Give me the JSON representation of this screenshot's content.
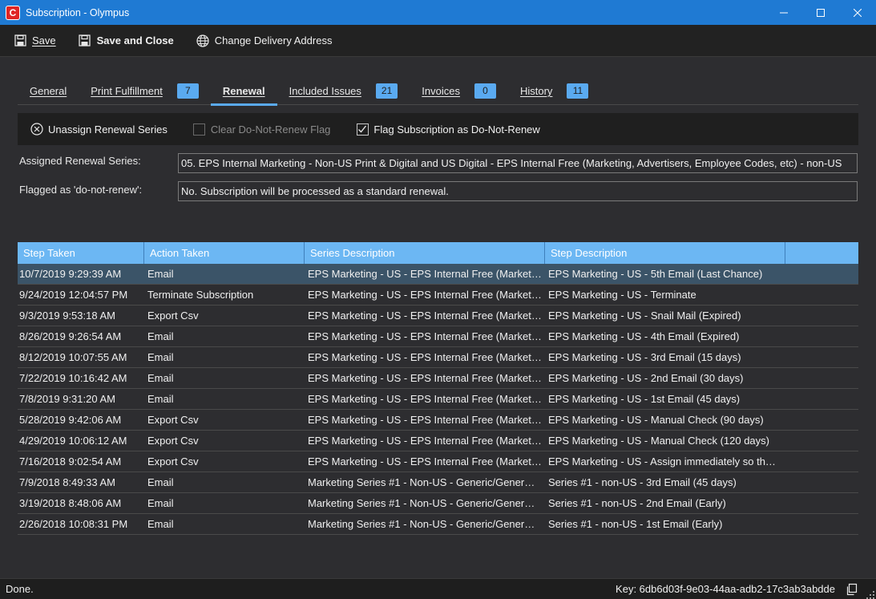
{
  "window": {
    "title": "Subscription - Olympus",
    "app_icon": "C",
    "minimize": "—",
    "maximize": "☐",
    "close": "✕"
  },
  "toolbar": {
    "save_label": "Save",
    "save_close_label": "Save and Close",
    "change_address_label": "Change Delivery Address"
  },
  "tabs": [
    {
      "label": "General",
      "badge": null
    },
    {
      "label": "Print Fulfillment",
      "badge": "7"
    },
    {
      "label": "Renewal",
      "badge": null
    },
    {
      "label": "Included Issues",
      "badge": "21"
    },
    {
      "label": "Invoices",
      "badge": "0"
    },
    {
      "label": "History",
      "badge": "11"
    }
  ],
  "actions": {
    "unassign_label": "Unassign Renewal Series",
    "clear_flag_label": "Clear Do-Not-Renew Flag",
    "flag_label": "Flag Subscription as Do-Not-Renew"
  },
  "fields": {
    "assigned_label": "Assigned Renewal Series:",
    "assigned_value": "05. EPS Internal Marketing - Non-US Print & Digital and US Digital - EPS Internal Free (Marketing, Advertisers, Employee Codes, etc) - non-US",
    "flagged_label": "Flagged as 'do-not-renew':",
    "flagged_value": "No. Subscription will be processed as a standard renewal."
  },
  "grid": {
    "columns": [
      "Step Taken",
      "Action Taken",
      "Series Description",
      "Step Description",
      ""
    ],
    "rows": [
      [
        "10/7/2019 9:29:39 AM",
        "Email",
        "EPS Marketing - US - EPS Internal Free (Market…",
        "EPS Marketing - US - 5th Email (Last Chance)"
      ],
      [
        "9/24/2019 12:04:57 PM",
        "Terminate Subscription",
        "EPS Marketing - US - EPS Internal Free (Market…",
        "EPS Marketing - US - Terminate"
      ],
      [
        "9/3/2019 9:53:18 AM",
        "Export Csv",
        "EPS Marketing - US - EPS Internal Free (Market…",
        "EPS Marketing - US - Snail Mail (Expired)"
      ],
      [
        "8/26/2019 9:26:54 AM",
        "Email",
        "EPS Marketing - US - EPS Internal Free (Market…",
        "EPS Marketing - US - 4th Email (Expired)"
      ],
      [
        "8/12/2019 10:07:55 AM",
        "Email",
        "EPS Marketing - US - EPS Internal Free (Market…",
        "EPS Marketing - US - 3rd Email (15 days)"
      ],
      [
        "7/22/2019 10:16:42 AM",
        "Email",
        "EPS Marketing - US - EPS Internal Free (Market…",
        "EPS Marketing - US - 2nd Email (30 days)"
      ],
      [
        "7/8/2019 9:31:20 AM",
        "Email",
        "EPS Marketing - US - EPS Internal Free (Market…",
        "EPS Marketing - US - 1st Email (45 days)"
      ],
      [
        "5/28/2019 9:42:06 AM",
        "Export Csv",
        "EPS Marketing - US - EPS Internal Free (Market…",
        "EPS Marketing - US - Manual Check (90 days)"
      ],
      [
        "4/29/2019 10:06:12 AM",
        "Export Csv",
        "EPS Marketing - US - EPS Internal Free (Market…",
        "EPS Marketing - US - Manual Check (120 days)"
      ],
      [
        "7/16/2018 9:02:54 AM",
        "Export Csv",
        "EPS Marketing - US - EPS Internal Free (Market…",
        "EPS Marketing - US - Assign immediately so th…"
      ],
      [
        "7/9/2018 8:49:33 AM",
        "Email",
        "Marketing Series #1 - Non-US - Generic/Gener…",
        "Series #1 - non-US - 3rd Email (45 days)"
      ],
      [
        "3/19/2018 8:48:06 AM",
        "Email",
        "Marketing Series #1 - Non-US - Generic/Gener…",
        "Series #1 - non-US - 2nd Email (Early)"
      ],
      [
        "2/26/2018 10:08:31 PM",
        "Email",
        "Marketing Series #1 - Non-US - Generic/Gener…",
        "Series #1 - non-US - 1st Email (Early)"
      ]
    ]
  },
  "status": {
    "text": "Done.",
    "key": "Key: 6db6d03f-9e03-44aa-adb2-17c3ab3abdde"
  },
  "colors": {
    "titlebar": "#1f7ad3",
    "accent": "#5aaaf0",
    "grid_header": "#6cb7f3",
    "selected_row": "#3b5468",
    "background": "#2d2d30"
  }
}
